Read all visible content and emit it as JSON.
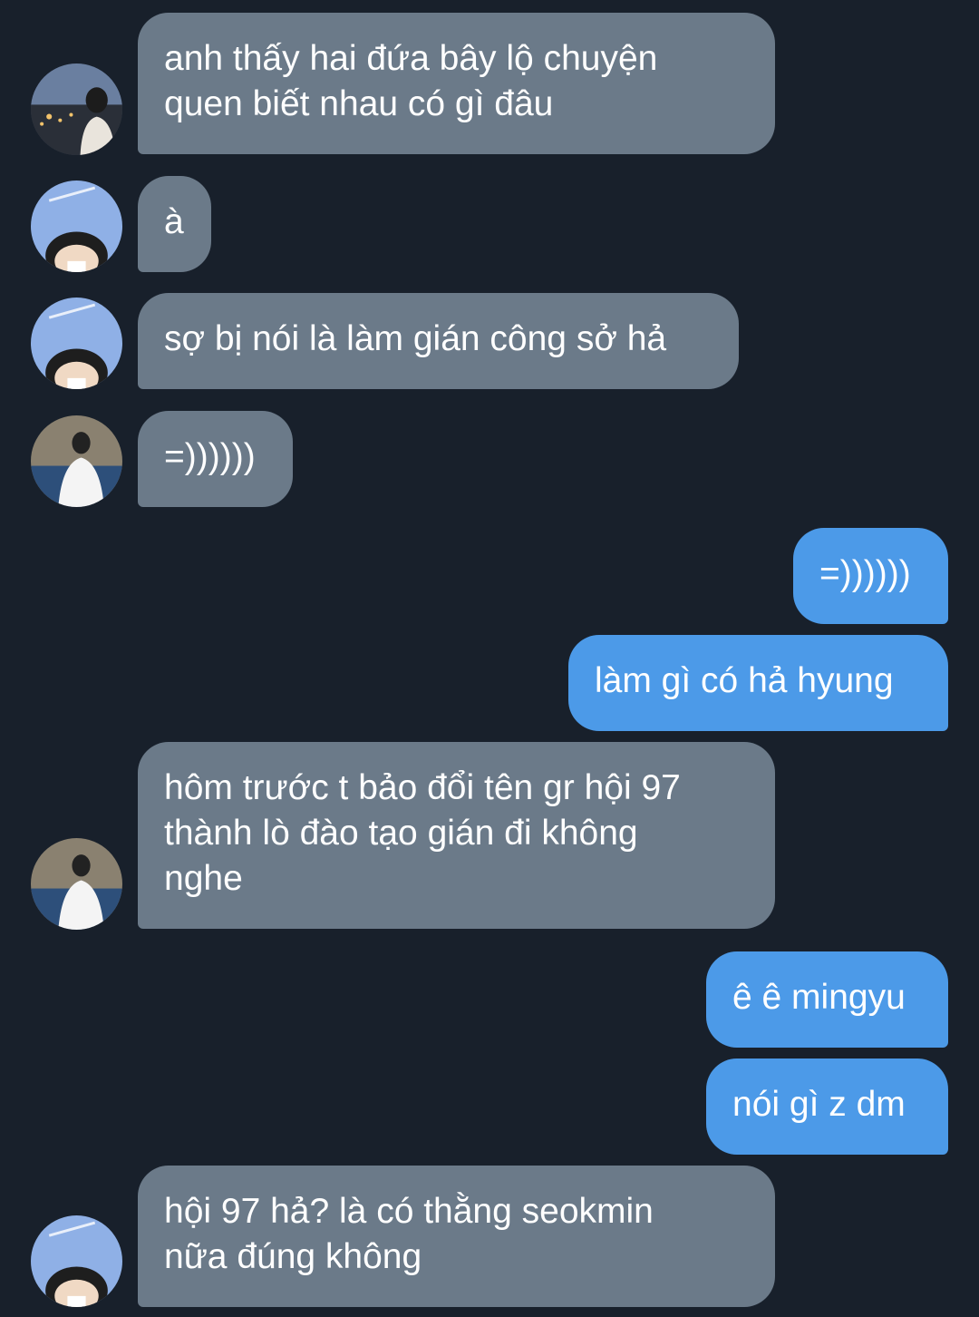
{
  "messages": [
    {
      "direction": "in",
      "avatar": "avatar-city-night",
      "lines": [
        "anh thấy hai đứa bây lộ chuyện",
        "quen biết nhau có gì đâu"
      ]
    },
    {
      "direction": "in",
      "avatar": "avatar-sky-face",
      "lines": [
        "à"
      ]
    },
    {
      "direction": "in",
      "avatar": "avatar-sky-face",
      "lines": [
        "sợ bị nói là làm gián công sở hả"
      ]
    },
    {
      "direction": "in",
      "avatar": "avatar-white-shirt",
      "lines": [
        "=))))))"
      ]
    },
    {
      "direction": "out",
      "lines": [
        "=))))))"
      ]
    },
    {
      "direction": "out",
      "lines": [
        "làm gì có hả hyung"
      ]
    },
    {
      "direction": "in",
      "avatar": "avatar-white-shirt",
      "lines": [
        "hôm trước t bảo đổi tên gr hội 97",
        "thành lò đào tạo gián đi không",
        "nghe"
      ]
    },
    {
      "direction": "out",
      "lines": [
        "ê ê mingyu"
      ]
    },
    {
      "direction": "out",
      "lines": [
        "nói gì z dm"
      ]
    },
    {
      "direction": "in",
      "avatar": "avatar-sky-face",
      "lines": [
        "hội 97 hả? là có thằng seokmin",
        "nữa đúng không"
      ]
    }
  ],
  "colors": {
    "background": "#18202b",
    "incoming_bubble": "#6b7a89",
    "outgoing_bubble": "#4c9ae8",
    "text": "#ffffff"
  }
}
